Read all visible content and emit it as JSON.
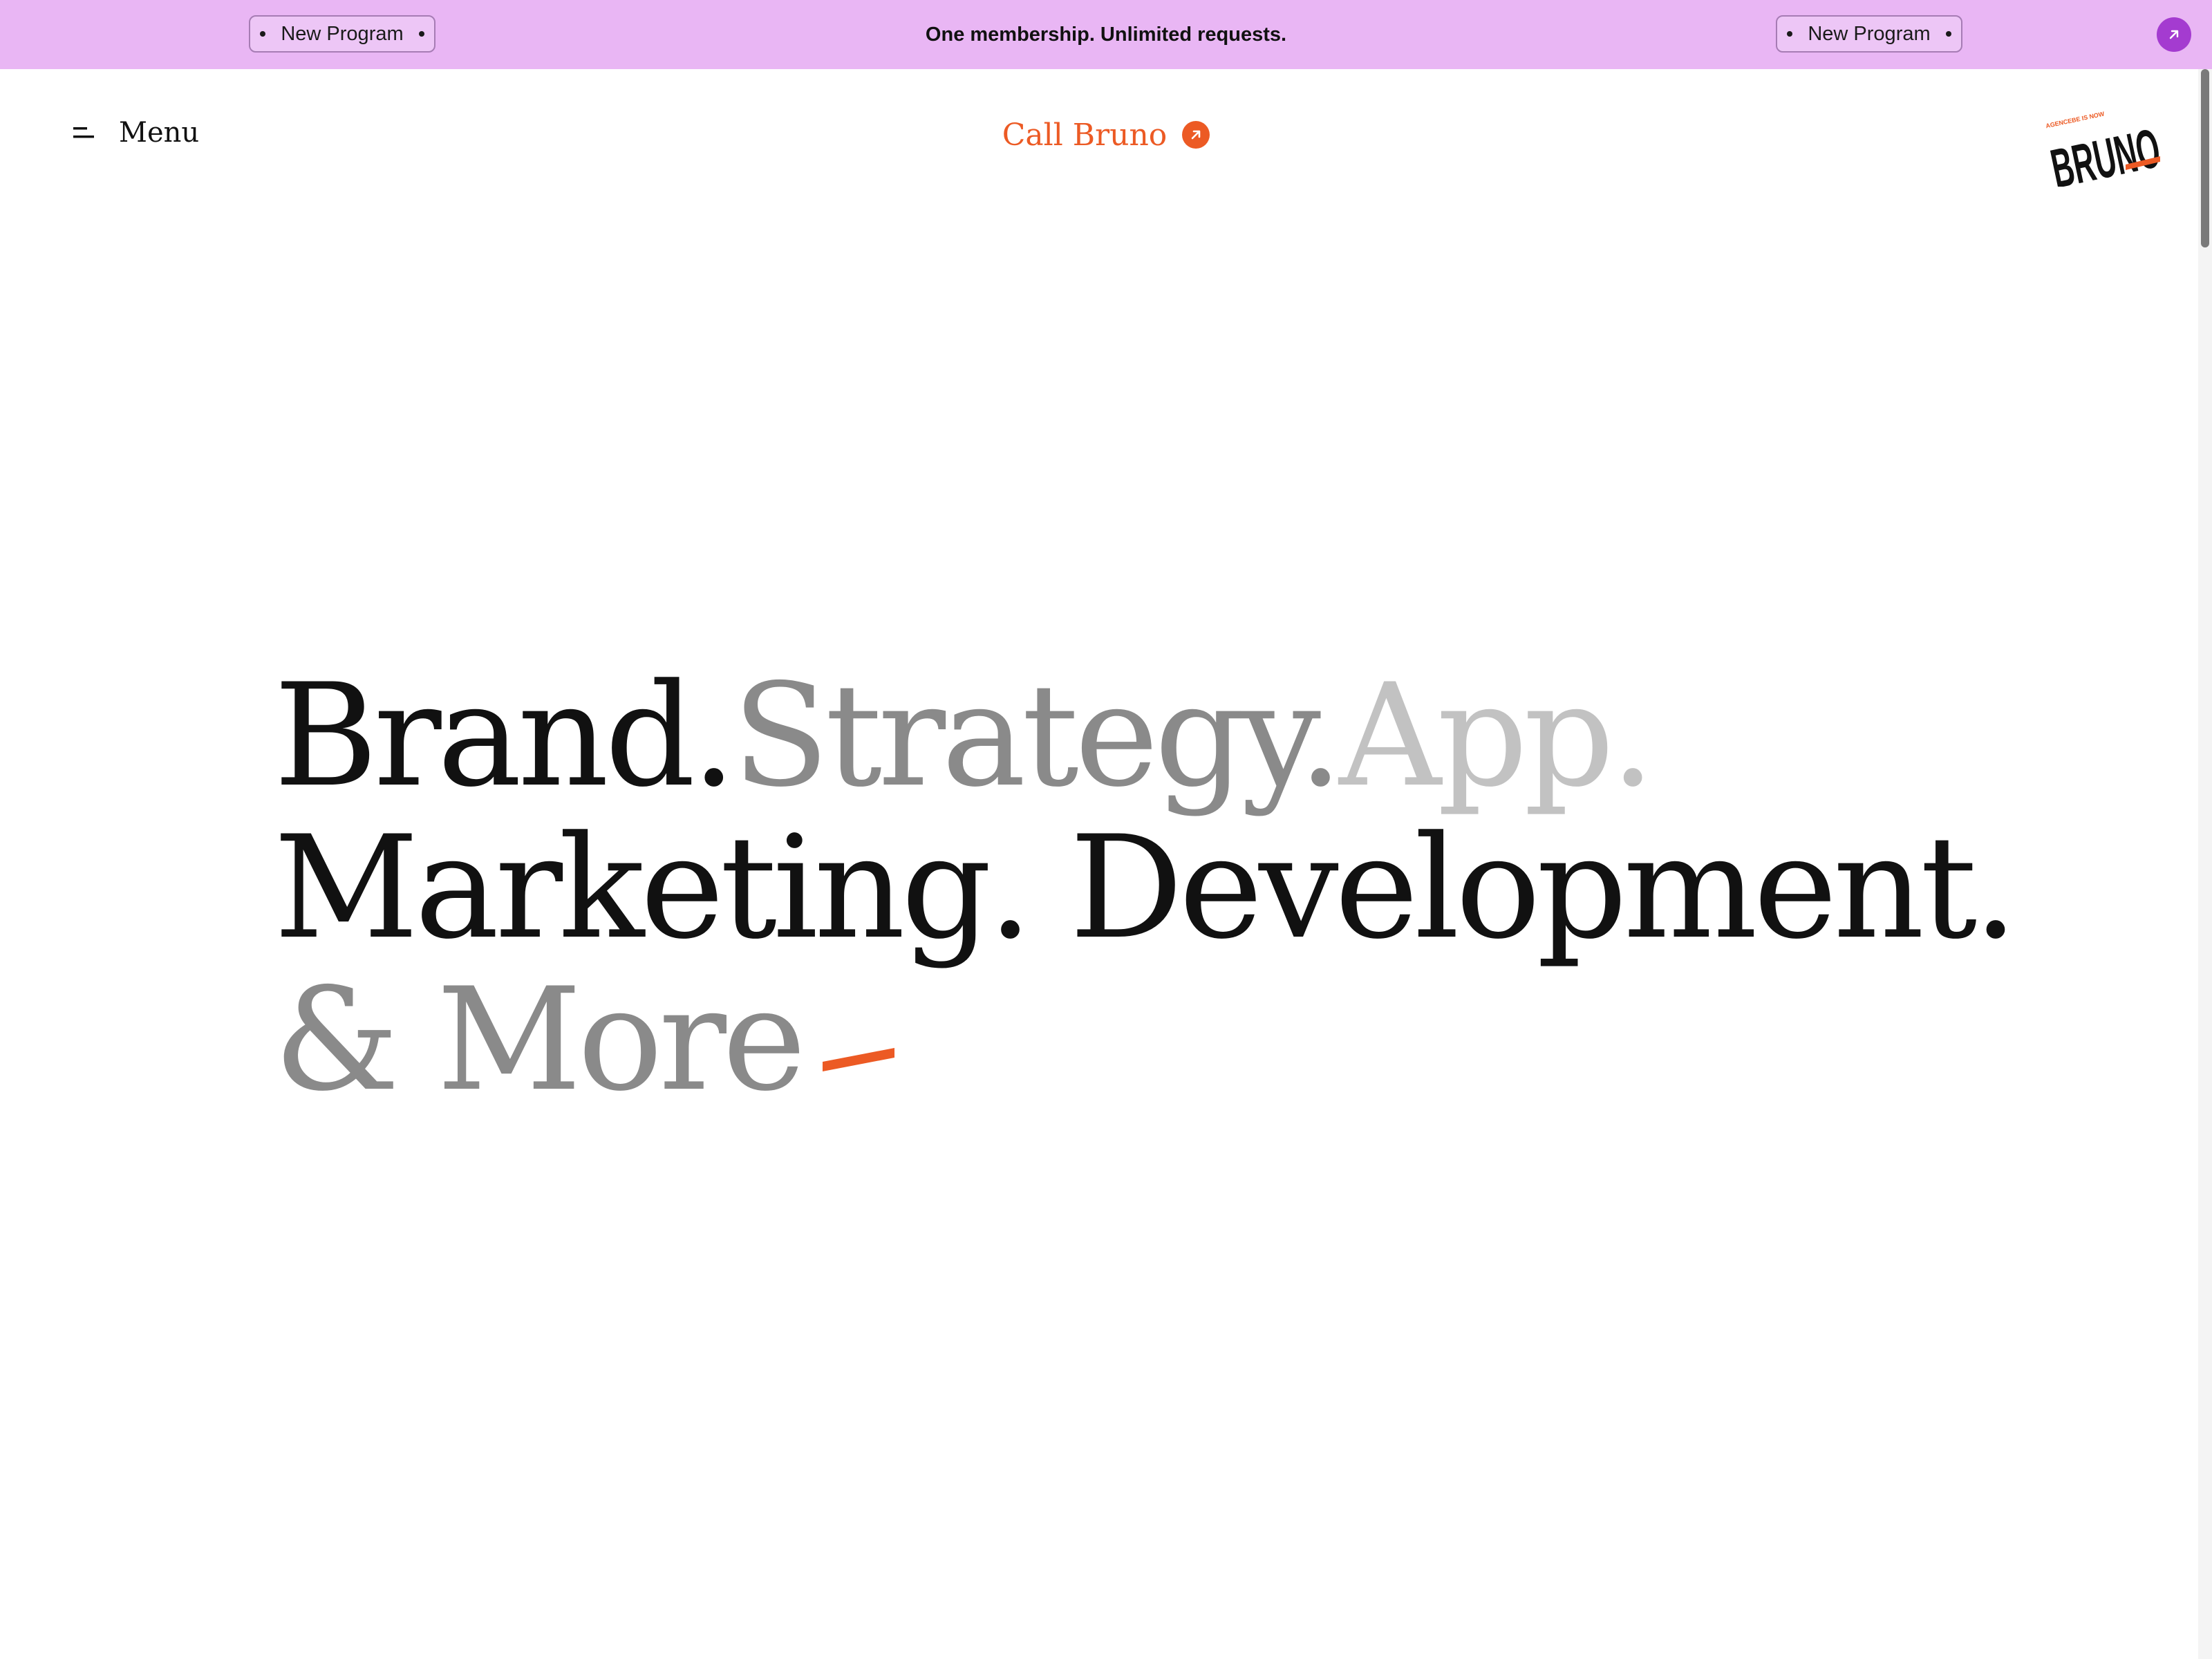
{
  "announcement": {
    "pill_left": "New Program",
    "pill_right": "New Program",
    "text": "One membership. Unlimited requests.",
    "arrow_icon": "arrow-up-right-icon",
    "background": "#e9b6f4",
    "arrow_color": "#a43bd0"
  },
  "header": {
    "menu_label": "Menu",
    "menu_icon": "hamburger-icon",
    "call_label": "Call Bruno",
    "call_icon": "arrow-up-right-icon",
    "accent_color": "#ec5a24",
    "logo": {
      "name": "BRUNO",
      "tagline": "AGENCEBE IS NOW"
    }
  },
  "hero": {
    "line1": [
      "Brand.",
      "Strategy.",
      "App."
    ],
    "line2": "Marketing. Development.",
    "line3": "& More",
    "colors": {
      "dark": "#111111",
      "mid": "#8a8a8a",
      "light": "#c2c2c2"
    }
  }
}
